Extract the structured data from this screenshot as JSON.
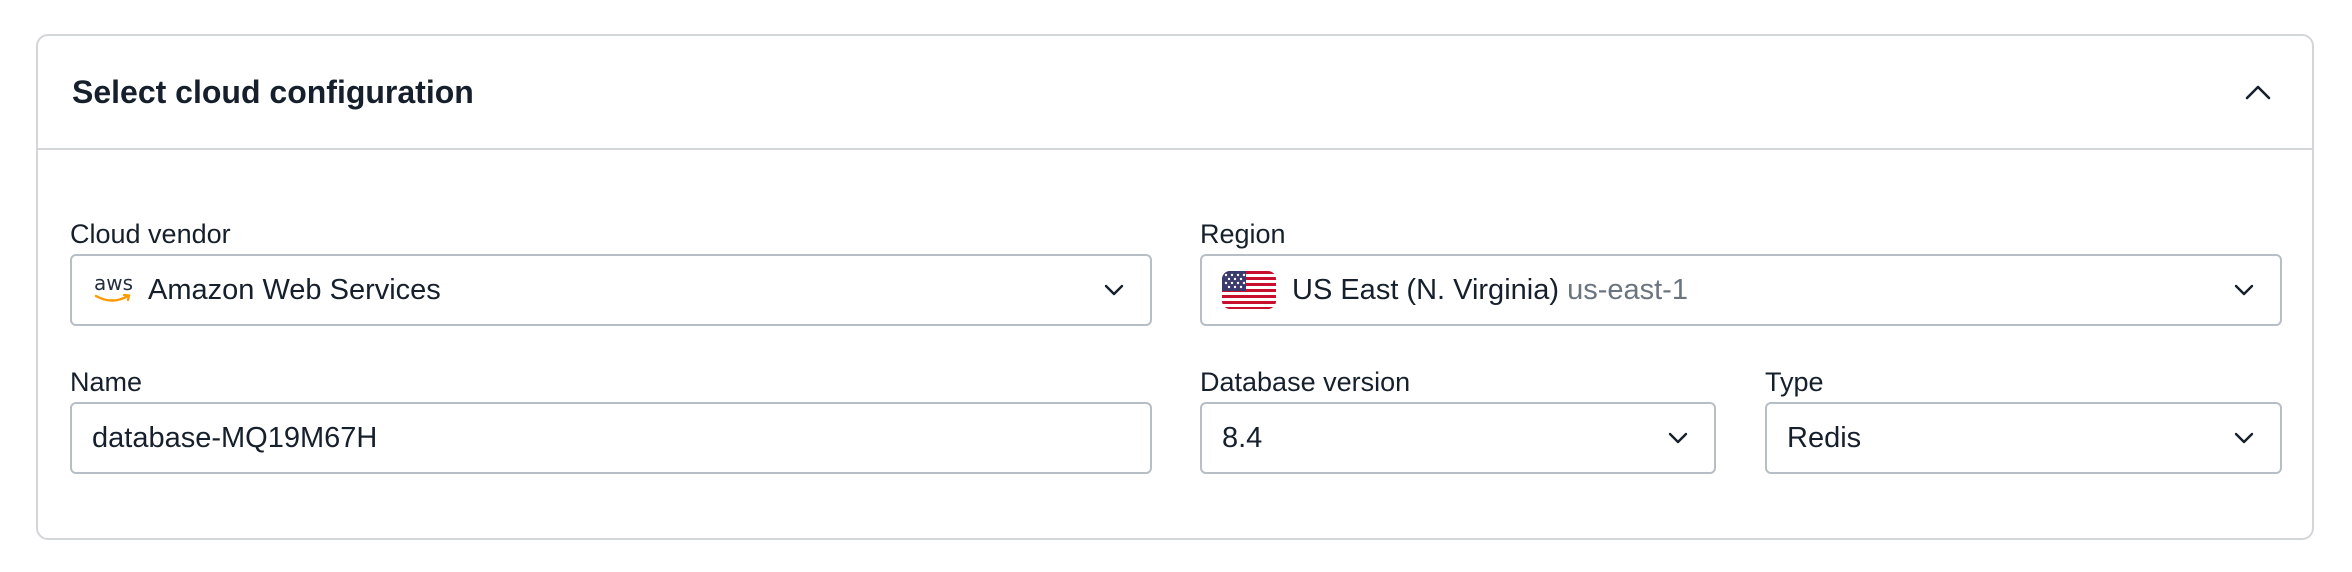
{
  "panel": {
    "title": "Select cloud configuration"
  },
  "cloud_vendor": {
    "label": "Cloud vendor",
    "value": "Amazon Web Services",
    "logo_text": "aws"
  },
  "region": {
    "label": "Region",
    "value": "US East (N. Virginia)",
    "code": "us-east-1"
  },
  "name": {
    "label": "Name",
    "value": "database-MQ19M67H"
  },
  "database_version": {
    "label": "Database version",
    "value": "8.4"
  },
  "type": {
    "label": "Type",
    "value": "Redis"
  },
  "colors": {
    "border": "#d3d6d9",
    "text": "#16202c",
    "muted": "#6b7580",
    "aws_orange": "#ff9900"
  }
}
